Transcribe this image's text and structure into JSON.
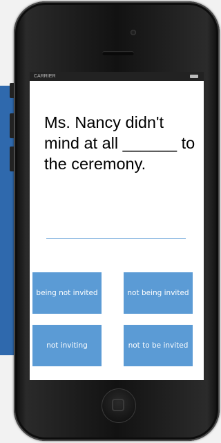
{
  "status_bar": {
    "carrier": "CARRIER",
    "time": ""
  },
  "question": {
    "text": "Ms. Nancy didn't mind at all ______ to the ceremony."
  },
  "options": [
    {
      "label": "being not invited"
    },
    {
      "label": "not being invited"
    },
    {
      "label": "not inviting"
    },
    {
      "label": "not to be invited"
    }
  ],
  "colors": {
    "option_background": "#5b9bd5",
    "answer_line": "#5b9bd5",
    "side_panel": "#2f69ad"
  }
}
